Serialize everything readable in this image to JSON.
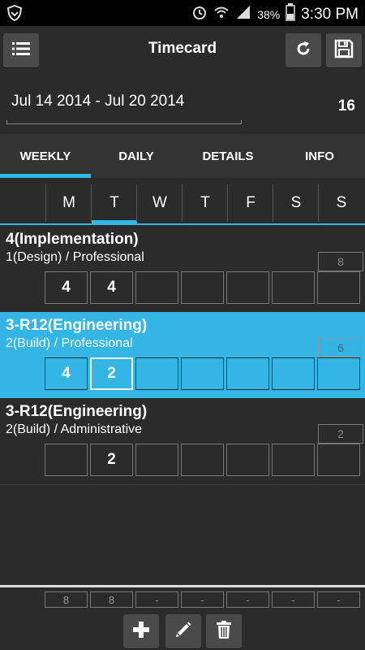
{
  "status_bar": {
    "battery_percent": "38%",
    "time": "3:30 PM"
  },
  "header": {
    "title": "Timecard"
  },
  "date_range": {
    "text": "Jul 14 2014 - Jul 20 2014",
    "total_hours": "16"
  },
  "tabs": [
    {
      "label": "WEEKLY",
      "active": true
    },
    {
      "label": "DAILY",
      "active": false
    },
    {
      "label": "DETAILS",
      "active": false
    },
    {
      "label": "INFO",
      "active": false
    }
  ],
  "days": [
    "M",
    "T",
    "W",
    "T",
    "F",
    "S",
    "S"
  ],
  "entries": [
    {
      "title": "4(Implementation)",
      "subtitle": "1(Design) / Professional",
      "total": "8",
      "hours": [
        "4",
        "4",
        "",
        "",
        "",
        "",
        ""
      ],
      "selected": false
    },
    {
      "title": "3-R12(Engineering)",
      "subtitle": "2(Build) / Professional",
      "total": "6",
      "hours": [
        "4",
        "2",
        "",
        "",
        "",
        "",
        ""
      ],
      "selected": true
    },
    {
      "title": "3-R12(Engineering)",
      "subtitle": "2(Build) / Administrative",
      "total": "2",
      "hours": [
        "",
        "2",
        "",
        "",
        "",
        "",
        ""
      ],
      "selected": false
    }
  ],
  "daily_totals": [
    "8",
    "8",
    "-",
    "-",
    "-",
    "-",
    "-"
  ],
  "colors": {
    "accent": "#33b5e5",
    "background": "#2b2b2b",
    "button": "#4a4a4a"
  },
  "icons": [
    "menu-icon",
    "refresh-icon",
    "save-icon",
    "add-icon",
    "edit-icon",
    "delete-icon"
  ]
}
